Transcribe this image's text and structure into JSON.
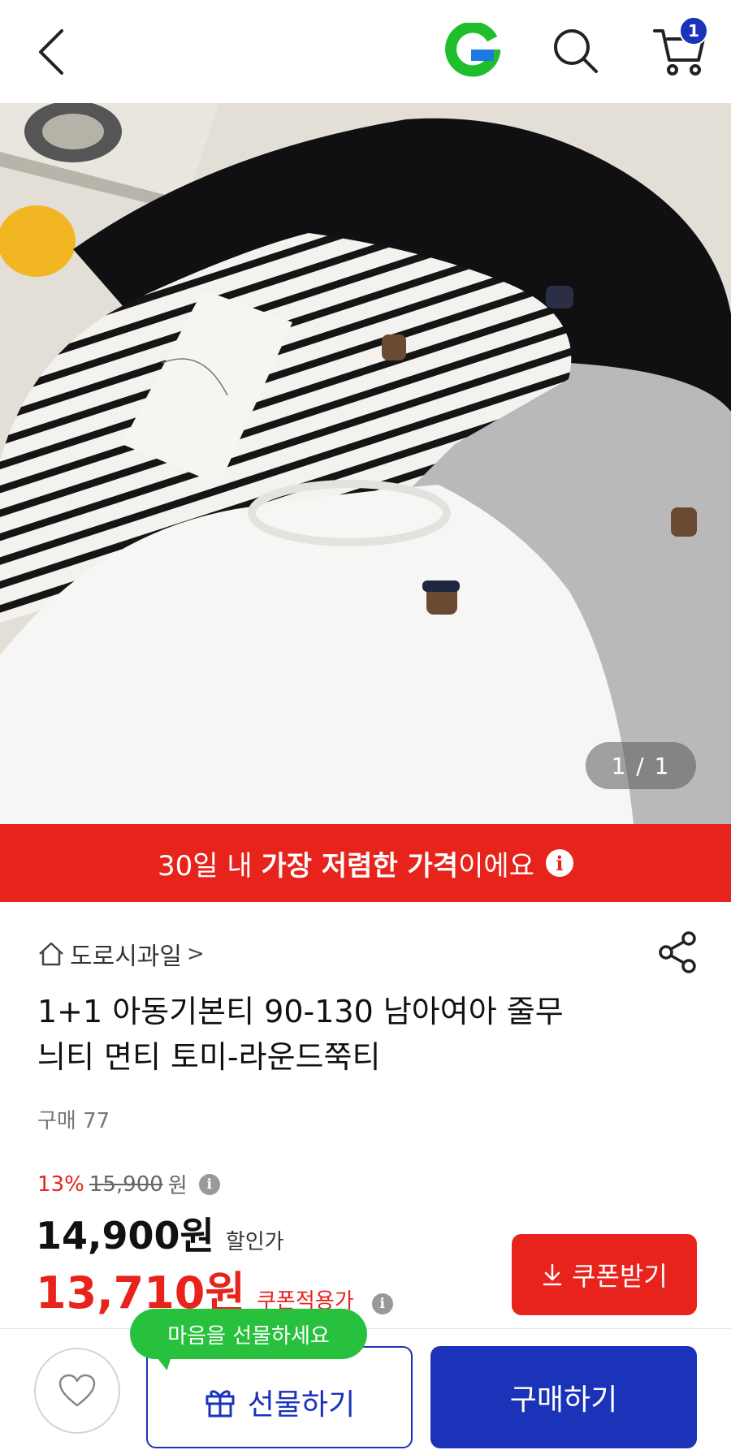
{
  "header": {
    "back_icon": "chevron-left-icon",
    "logo_letter": "G",
    "cart_count": "1"
  },
  "gallery": {
    "counter": "1 / 1"
  },
  "banner": {
    "pre": "30일 내 ",
    "bold": "가장 저렴한 가격",
    "post": "이에요",
    "info": "i"
  },
  "store": {
    "name": "도로시과일",
    "chevron": ">"
  },
  "product": {
    "title_line1": "1+1 아동기본티 90-130 남아여아 줄무",
    "title_line2": "늬티 면티 토미-라운드쭉티",
    "purchase_count": "구매 77"
  },
  "price": {
    "discount_pct": "13%",
    "original": "15,900",
    "original_unit": "원",
    "sale": "14,900원",
    "sale_label": "할인가",
    "coupon": "13,710원",
    "coupon_label": "쿠폰적용가",
    "info": "i"
  },
  "coupon_button": {
    "label": "쿠폰받기"
  },
  "bottom": {
    "tooltip": "마음을 선물하세요",
    "gift_label": "선물하기",
    "buy_label": "구매하기"
  },
  "colors": {
    "brand_blue": "#1a33b8",
    "accent_red": "#e8231c",
    "logo_green": "#1fbe2c",
    "tooltip_green": "#27c13e"
  }
}
